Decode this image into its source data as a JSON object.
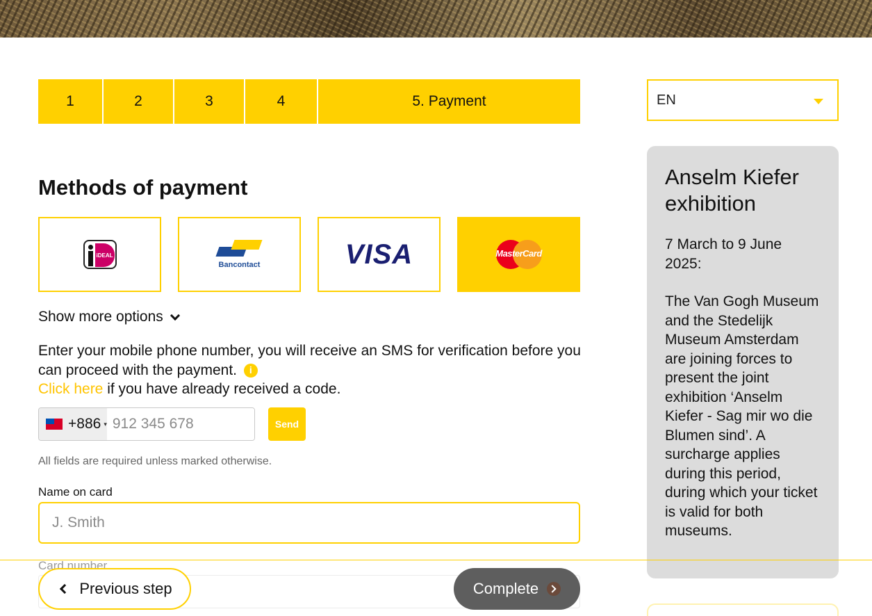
{
  "steps": [
    "1",
    "2",
    "3",
    "4",
    "5. Payment"
  ],
  "language": {
    "selected": "EN"
  },
  "sidebar": {
    "title": "Anselm Kiefer exhibition",
    "dates": "7 March to 9 June 2025:",
    "description": "The Van Gogh Museum and the Stedelijk Museum Amsterdam are joining forces to present the joint exhibition ‘Anselm Kiefer - Sag mir wo die Blumen sind’. A surcharge applies during this period, during which your ticket is valid for both museums."
  },
  "payment": {
    "title": "Methods of payment",
    "methods": [
      {
        "name": "iDEAL",
        "logo_text": "iDEAL"
      },
      {
        "name": "Bancontact",
        "logo_text": "Bancontact"
      },
      {
        "name": "Visa",
        "logo_text": "VISA"
      },
      {
        "name": "Mastercard",
        "logo_text": "MasterCard",
        "selected": true
      }
    ],
    "show_more": "Show more options"
  },
  "sms": {
    "instructions": "Enter your mobile phone number, you will receive an SMS for verification before you can proceed with the payment.",
    "info_icon_symbol": "i",
    "link_text": "Click here",
    "after_link": " if you have already received a code."
  },
  "phone": {
    "country_code": "+886",
    "flag": "taiwan-flag",
    "placeholder": "912 345 678",
    "send_label": "Send"
  },
  "form": {
    "required_note": "All fields are required unless marked otherwise.",
    "name_label": "Name on card",
    "name_placeholder": "J. Smith",
    "card_label": "Card number"
  },
  "footer": {
    "prev_label": "Previous step",
    "complete_label": "Complete"
  },
  "colors": {
    "accent": "#ffd000",
    "sidebar_bg": "#dcdcdc",
    "complete_bg": "#5e5e5e"
  }
}
